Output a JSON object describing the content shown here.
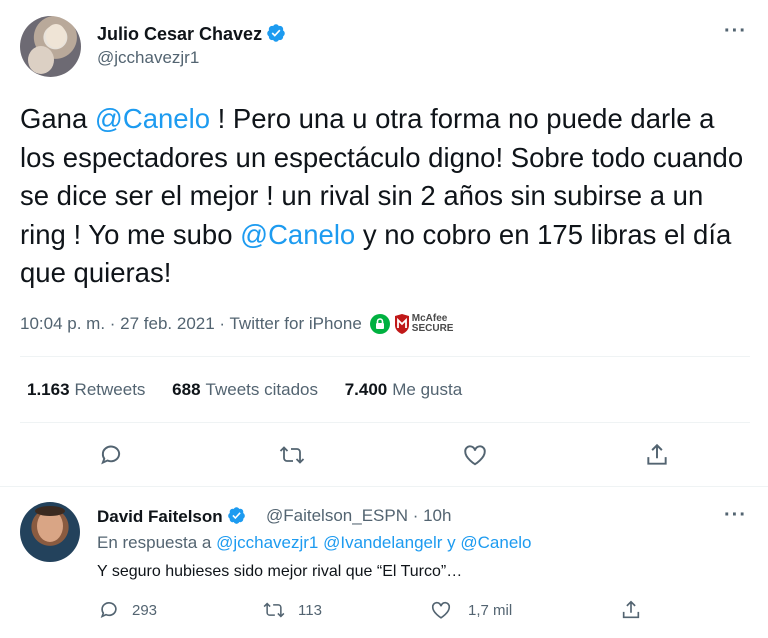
{
  "tweet": {
    "author_name": "Julio Cesar Chavez",
    "author_handle": "@jcchavezjr1",
    "text_segments": [
      {
        "text": "Gana ",
        "type": "text"
      },
      {
        "text": "@Canelo",
        "type": "mention"
      },
      {
        "text": "   ! Pero  una u otra forma no puede darle a los espectadores un espectáculo digno! Sobre todo cuando se dice ser el mejor  ! un rival sin 2 años sin subirse a un ring ! Yo me subo ",
        "type": "text"
      },
      {
        "text": "@Canelo",
        "type": "mention"
      },
      {
        "text": " y no cobro en 175 libras el día que quieras!",
        "type": "text"
      }
    ],
    "timestamp": "10:04 p. m. · 27 feb. 2021 · Twitter for iPhone",
    "badge_text_line1": "McAfee",
    "badge_text_line2": "SECURE",
    "stats": {
      "retweets_count": "1.163",
      "retweets_label": "Retweets",
      "quotes_count": "688",
      "quotes_label": "Tweets citados",
      "likes_count": "7.400",
      "likes_label": "Me gusta"
    },
    "more_label": "···"
  },
  "reply": {
    "author_name": "David Faitelson",
    "author_handle": "@Faitelson_ESPN · 10h",
    "reply_prefix": "En respuesta a ",
    "reply_mentions": "@jcchavezjr1 @Ivandelangelr y @Canelo",
    "text": "Y seguro hubieses sido mejor rival que “El Turco”…",
    "replies_count": "293",
    "retweets_count": "113",
    "likes_count": "1,7 mil",
    "more_label": "···"
  },
  "colors": {
    "accent": "#1d9bf0",
    "secondary_text": "#536471",
    "primary_text": "#0f1419",
    "divider": "#eff3f4",
    "secure_green": "#00b140",
    "mcafee_red": "#c01818"
  },
  "icons": [
    "verified-badge-icon",
    "more-icon",
    "reply-icon",
    "retweet-icon",
    "like-icon",
    "share-icon",
    "lock-icon",
    "mcafee-shield-icon"
  ]
}
